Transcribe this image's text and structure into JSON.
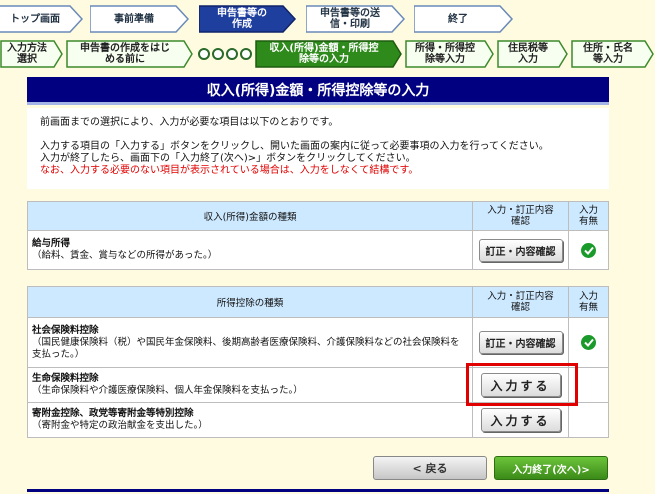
{
  "steps": [
    {
      "label": "トップ画面"
    },
    {
      "label": "事前準備"
    },
    {
      "label": "申告書等の作成"
    },
    {
      "label": "申告書等の送信・印刷"
    },
    {
      "label": "終了"
    }
  ],
  "substeps": [
    {
      "label": "入力方法選択"
    },
    {
      "label": "申告書の作成をはじめる前に"
    },
    {
      "label": "収入(所得)金額・所得控除等の入力"
    },
    {
      "label": "所得・所得控除等入力"
    },
    {
      "label": "住民税等入力"
    },
    {
      "label": "住所・氏名等入力"
    }
  ],
  "title": "収入(所得)金額・所得控除等の入力",
  "intro": {
    "line1": "前画面までの選択により、入力が必要な項目は以下のとおりです。",
    "line2": "入力する項目の「入力する」ボタンをクリックし、開いた画面の案内に従って必要事項の入力を行ってください。",
    "line3": "入力が終了したら、画面下の「入力終了(次へ)>」ボタンをクリックしてください。",
    "note": "なお、入力する必要のない項目が表示されている場合は、入力をしなくて結構です。"
  },
  "income_table": {
    "col_type": "収入(所得)金額の種類",
    "col_action": "入力・訂正内容確認",
    "col_status": "入力有無",
    "rows": [
      {
        "name": "給与所得",
        "desc": "（給料、賃金、賞与などの所得があった。）",
        "button": "訂正・内容確認",
        "done": true
      }
    ]
  },
  "deduction_table": {
    "col_type": "所得控除の種類",
    "col_action": "入力・訂正内容確認",
    "col_status": "入力有無",
    "rows": [
      {
        "name": "社会保険料控除",
        "desc": "（国民健康保険料（税）や国民年金保険料、後期高齢者医療保険料、介護保険料などの社会保険料を支払った。）",
        "button": "訂正・内容確認",
        "done": true
      },
      {
        "name": "生命保険料控除",
        "desc": "（生命保険料や介護医療保険料、個人年金保険料を支払った。）",
        "button": "入力する",
        "done": false
      },
      {
        "name": "寄附金控除、政党等寄附金等特別控除",
        "desc": "（寄附金や特定の政治献金を支出した。）",
        "button": "入力する",
        "done": false
      }
    ]
  },
  "buttons": {
    "back": "< 戻る",
    "next": "入力終了(次へ)>"
  },
  "colors": {
    "title_bg": "#000080",
    "header_bg": "#cde9ff",
    "highlight": "#e00000",
    "check": "#1a9a2a"
  }
}
